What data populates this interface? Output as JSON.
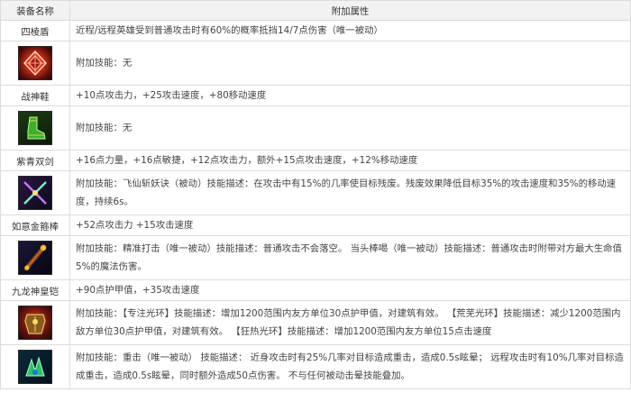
{
  "table": {
    "headers": [
      "装备名称",
      "附加属性"
    ],
    "items": [
      {
        "name": "四棱盾",
        "stats": "近程/远程英雄受到普通攻击时有60%的概率抵挡14/7点伤害（唯一被动）",
        "icon": "crystal-shield-icon",
        "skill": "附加技能：无"
      },
      {
        "name": "战神鞋",
        "stats": "+10点攻击力，+25攻击速度，+80移动速度",
        "icon": "green-boots-icon",
        "skill": "附加技能：无"
      },
      {
        "name": "紫青双剑",
        "stats": "+16点力量，+16点敏捷，+12点攻击力，额外+15点攻击速度，+12%移动速度",
        "icon": "twin-swords-icon",
        "skill": "附加技能：飞仙斩妖诀（被动）技能描述：在攻击中有15%的几率使目标残废。残废效果降低目标35%的攻击速度和35%的移动速度，持续6s。"
      },
      {
        "name": "如意金箍棒",
        "stats": "+52点攻击力 +15攻击速度",
        "icon": "golden-staff-icon",
        "skill": "附加技能：精准打击（唯一被动）技能描述：普通攻击不会落空。 当头棒喝（唯一被动）技能描述：普通攻击时附带对方最大生命值5%的魔法伤害。"
      },
      {
        "name": "九龙神皇铠",
        "stats": "+90点护甲值，+35攻击速度",
        "icon": "dragon-armor-icon",
        "skill": "附加技能：【专注光环】技能描述：增加1200范围内友方单位30点护甲值，对建筑有效。 【荒芜光环】技能描述：减少1200范围内敌方单位30点护甲值，对建筑有效。 【狂热光环】技能描述：增加1200范围内友方单位15点击速度"
      },
      {
        "name": "",
        "stats": "",
        "icon": "green-claw-icon",
        "skill": "附加技能：重击（唯一被动） 技能描述： 近身攻击时有25%几率对目标造成重击，造成0.5s眩晕； 远程攻击时有10%几率对目标造成重击，造成0.5s眩晕，同时额外造成50点伤害。 不与任何被动击晕技能叠加。"
      }
    ]
  }
}
